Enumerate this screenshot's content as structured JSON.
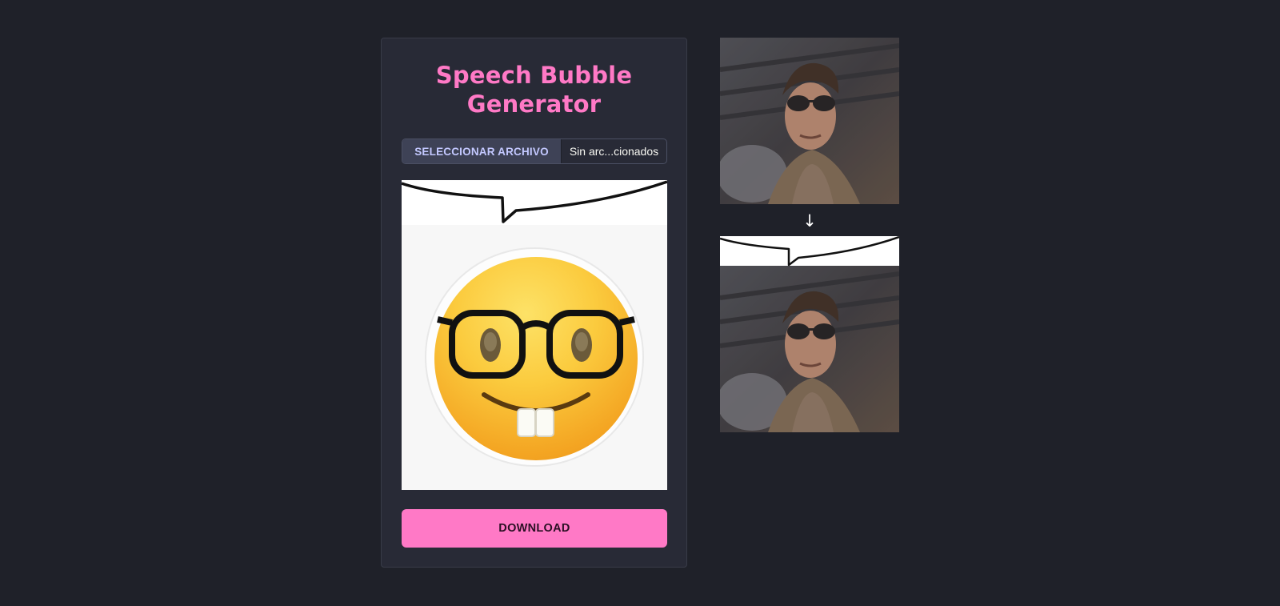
{
  "app": {
    "title": "Speech Bubble Generator"
  },
  "file_input": {
    "button_label": "SELECCIONAR ARCHIVO",
    "file_name": "Sin arc...cionados"
  },
  "preview": {
    "bubble_icon": "speech-bubble-tail",
    "image_icon": "nerd-face-emoji"
  },
  "download": {
    "label": "DOWNLOAD"
  },
  "example": {
    "arrow": "↓",
    "image_icon": "man-with-sunglasses-photo"
  },
  "colors": {
    "accent": "#ff79c6",
    "background": "#1f2129",
    "panel": "#282a36"
  }
}
